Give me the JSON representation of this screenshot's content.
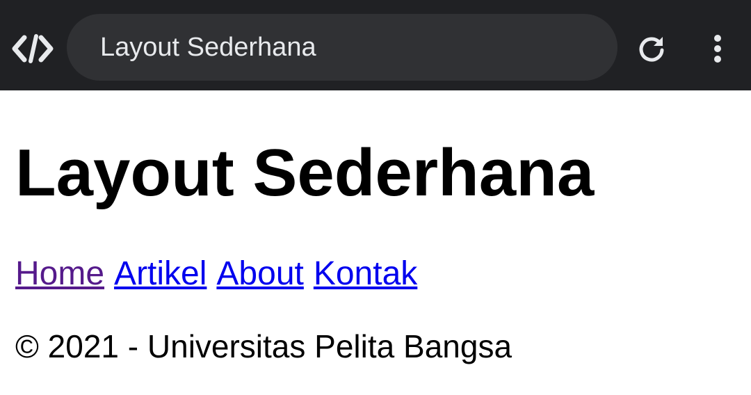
{
  "browser": {
    "address_text": "Layout Sederhana",
    "colors": {
      "toolbar_bg": "#202124",
      "address_bg": "#303134",
      "icon": "#e8eaed"
    },
    "icons": [
      "devtools-code-icon",
      "reload-icon",
      "more-vert-icon"
    ]
  },
  "page": {
    "title": "Layout Sederhana",
    "nav": [
      {
        "label": "Home",
        "state": "visited"
      },
      {
        "label": "Artikel",
        "state": "link"
      },
      {
        "label": "About",
        "state": "link"
      },
      {
        "label": "Kontak",
        "state": "link"
      }
    ],
    "footer": "© 2021 - Universitas Pelita Bangsa",
    "colors": {
      "visited_link": "#551a8b",
      "link": "#0000ee",
      "text": "#000000"
    }
  }
}
